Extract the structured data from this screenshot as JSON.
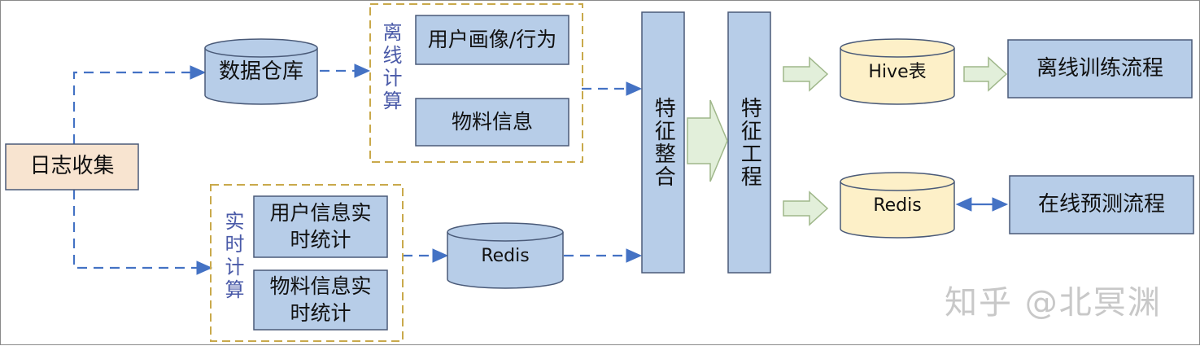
{
  "nodes": {
    "log_collect": "日志收集",
    "data_warehouse": "数据仓库",
    "offline_group": "离线计算",
    "user_profile": "用户画像/行为",
    "item_info": "物料信息",
    "realtime_group": "实时计算",
    "user_realtime": "用户信息实时统计",
    "item_realtime": "物料信息实时统计",
    "redis_mid": "Redis",
    "feature_merge": "特征整合",
    "feature_eng": "特征工程",
    "hive": "Hive表",
    "offline_train": "离线训练流程",
    "redis_right": "Redis",
    "online_predict": "在线预测流程"
  },
  "watermark": "知乎 @北冥渊",
  "colors": {
    "blue_fill": "#b7cde8",
    "blue_stroke": "#4a5a78",
    "peach_fill": "#f8e4d0",
    "yellow_fill": "#fdf0c8",
    "green_arrow": "#e2efda",
    "dash_line": "#4472c4",
    "group_border": "#c9a94b"
  }
}
